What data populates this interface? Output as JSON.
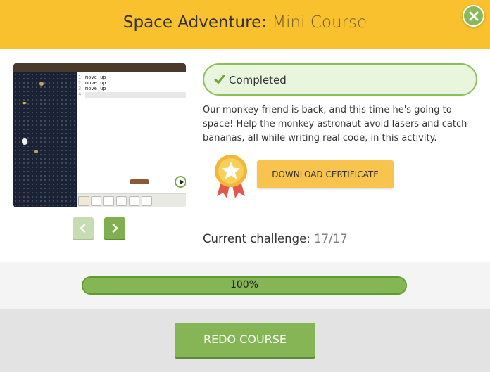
{
  "header": {
    "title_main": "Space Adventure:",
    "title_sub": "Mini Course"
  },
  "preview": {
    "code_lines": [
      {
        "num": "1",
        "text": "move up"
      },
      {
        "num": "2",
        "text": "move up"
      },
      {
        "num": "3",
        "text": "move up"
      },
      {
        "num": "4",
        "text": ""
      }
    ],
    "toolbar_buttons": [
      "",
      "",
      "",
      "",
      "",
      ""
    ]
  },
  "status": {
    "label": "Completed"
  },
  "description": "Our monkey friend is back, and this time he's going to space! Help the monkey astronaut avoid lasers and catch bananas, all while writing real code, in this activity.",
  "certificate_button": "DOWNLOAD CERTIFICATE",
  "challenge": {
    "label": "Current challenge:",
    "value": "17/17"
  },
  "progress": {
    "label": "100%",
    "fraction": 1.0
  },
  "redo_button": "REDO COURSE",
  "colors": {
    "header_bg": "#f9c12e",
    "accent_green": "#86b556",
    "certificate_yellow": "#f9c44d"
  },
  "icons": [
    "close-icon",
    "check-icon",
    "chevron-left-icon",
    "chevron-right-icon",
    "star-badge-icon",
    "play-icon"
  ]
}
